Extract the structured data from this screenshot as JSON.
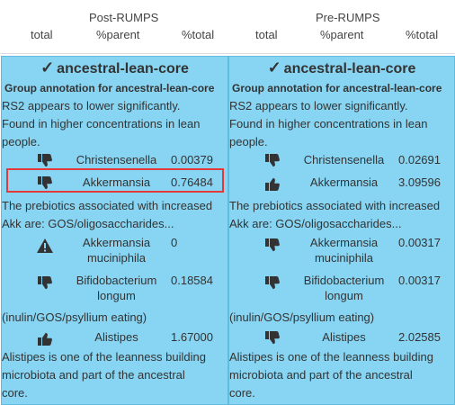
{
  "header": {
    "post_title": "Post-RUMPS",
    "pre_title": "Pre-RUMPS",
    "col_total": "total",
    "col_parent": "%parent",
    "col_pct_total": "%total"
  },
  "panels": [
    {
      "title": "ancestral-lean-core",
      "group": "Group annotation for ancestral-lean-core",
      "intro": [
        "RS2 appears to lower significantly.",
        "Found in higher concentrations in lean",
        "people."
      ],
      "rows": [
        {
          "name": "Christensenella",
          "value": "0.00379",
          "icon": "thumbs-down-icon"
        },
        {
          "name": "Akkermansia",
          "value": "0.76484",
          "icon": "thumbs-down-icon"
        }
      ],
      "prebiotic": [
        "The prebiotics associated with increased",
        "Akk are: GOS/oligosaccharides..."
      ],
      "rows2": [
        {
          "name1": "Akkermansia",
          "name2": "muciniphila",
          "value": "0",
          "icon": "warning-icon"
        },
        {
          "name1": "Bifidobacterium",
          "name2": "longum",
          "value": "0.18584",
          "icon": "thumbs-down-icon"
        }
      ],
      "inulin": "(inulin/GOS/psyllium eating)",
      "row3": {
        "name": "Alistipes",
        "value": "1.67000",
        "icon": "thumbs-up-icon"
      },
      "outro": [
        "Alistipes is one of the leanness building",
        "microbiota and part of the ancestral",
        "core."
      ]
    },
    {
      "title": "ancestral-lean-core",
      "group": "Group annotation for ancestral-lean-core",
      "intro": [
        "RS2 appears to lower significantly.",
        "Found in higher concentrations in lean",
        "people."
      ],
      "rows": [
        {
          "name": "Christensenella",
          "value": "0.02691",
          "icon": "thumbs-down-icon"
        },
        {
          "name": "Akkermansia",
          "value": "3.09596",
          "icon": "thumbs-up-icon"
        }
      ],
      "prebiotic": [
        "The prebiotics associated with increased",
        "Akk are: GOS/oligosaccharides..."
      ],
      "rows2": [
        {
          "name1": "Akkermansia",
          "name2": "muciniphila",
          "value": "0.00317",
          "icon": "thumbs-down-icon"
        },
        {
          "name1": "Bifidobacterium",
          "name2": "longum",
          "value": "0.00317",
          "icon": "thumbs-down-icon"
        }
      ],
      "inulin": "(inulin/GOS/psyllium eating)",
      "row3": {
        "name": "Alistipes",
        "value": "2.02585",
        "icon": "thumbs-down-icon"
      },
      "outro": [
        "Alistipes is one of the leanness building",
        "microbiota and part of the ancestral",
        "core."
      ]
    }
  ]
}
